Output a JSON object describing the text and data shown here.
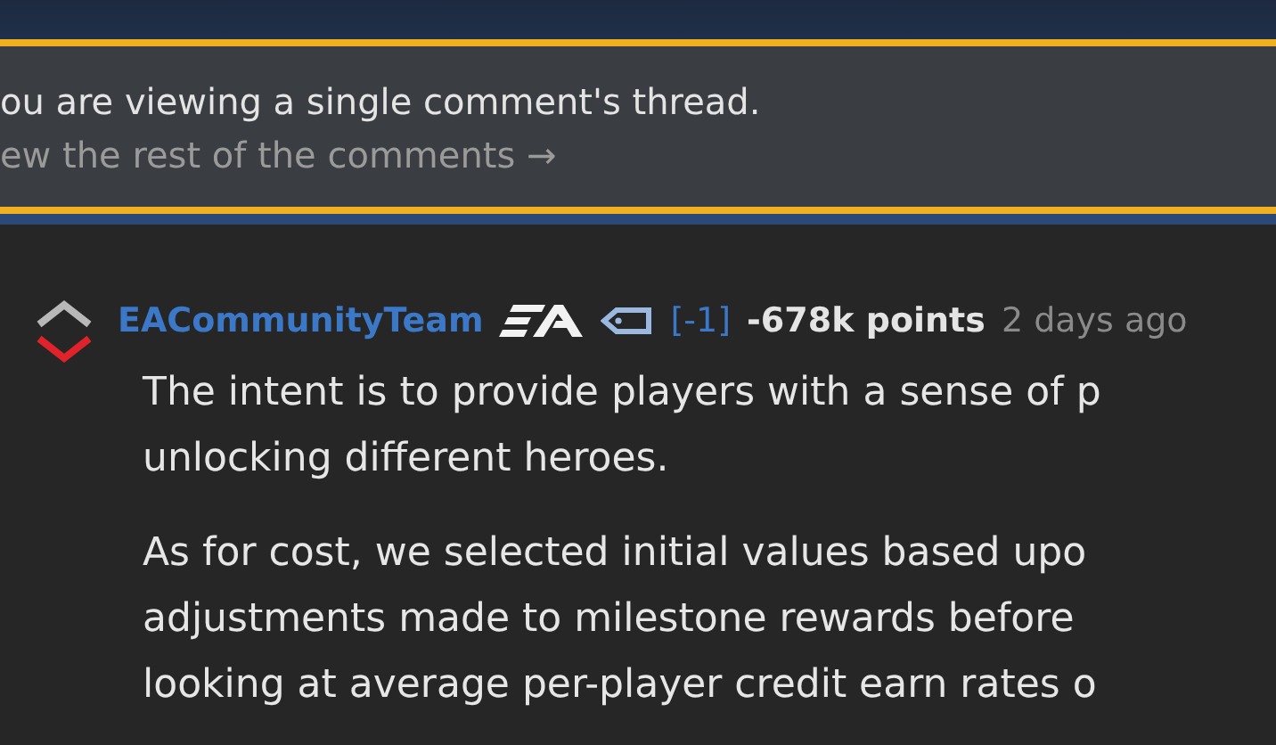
{
  "banner": {
    "message": "ou are viewing a single comment's thread.",
    "link": "ew the rest of the comments →"
  },
  "comment": {
    "vote": {
      "upvoted": false,
      "downvoted": true
    },
    "author": "EACommunityTeam",
    "score_adjust": "[-1]",
    "points": "-678k points",
    "time": "2 days ago",
    "paragraphs": [
      [
        "The intent is to provide players with a sense of p",
        "unlocking different heroes."
      ],
      [
        "As for cost, we selected initial values based upo",
        "adjustments made to milestone rewards before",
        "looking at average per-player credit earn rates o"
      ]
    ]
  }
}
